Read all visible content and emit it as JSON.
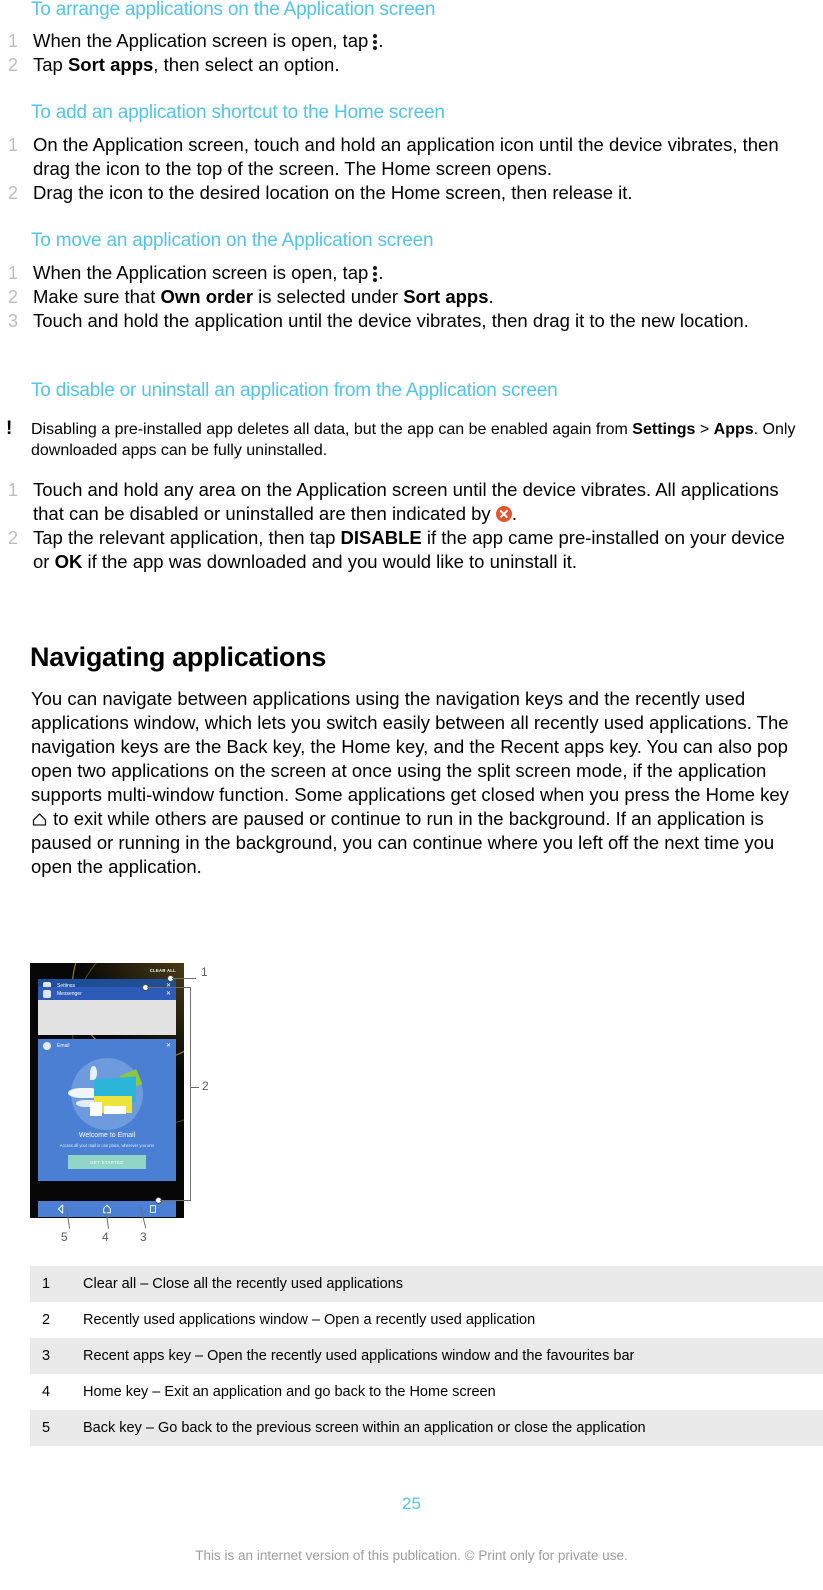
{
  "sections": [
    {
      "heading": "To arrange applications on the Application screen",
      "steps": [
        {
          "num": "1",
          "pre": "When the Application screen is open, tap ",
          "icon": "overflow-menu-icon",
          "post": "."
        },
        {
          "num": "2",
          "pre": "Tap ",
          "bold": "Sort apps",
          "post": ", then select an option."
        }
      ]
    },
    {
      "heading": "To add an application shortcut to the Home screen",
      "steps": [
        {
          "num": "1",
          "pre": "On the Application screen, touch and hold an application icon until the device vibrates, then drag the icon to the top of the screen. The Home screen opens."
        },
        {
          "num": "2",
          "pre": "Drag the icon to the desired location on the Home screen, then release it."
        }
      ]
    },
    {
      "heading": "To move an application on the Application screen",
      "steps": [
        {
          "num": "1",
          "pre": "When the Application screen is open, tap ",
          "icon": "overflow-menu-icon",
          "post": "."
        },
        {
          "num": "2",
          "pre": "Make sure that ",
          "bold": "Own order",
          "mid": " is selected under ",
          "bold2": "Sort apps",
          "post": "."
        },
        {
          "num": "3",
          "pre": "Touch and hold the application until the device vibrates, then drag it to the new location."
        }
      ]
    },
    {
      "heading": "To disable or uninstall an application from the Application screen",
      "note": {
        "icon": "!",
        "t1": "Disabling a pre-installed app deletes all data, but the app can be enabled again from ",
        "b1": "Settings",
        "t2": " > ",
        "b2": "Apps",
        "t3": ". Only downloaded apps can be fully uninstalled."
      },
      "steps": [
        {
          "num": "1",
          "pre": "Touch and hold any area on the Application screen until the device vibrates. All applications that can be disabled or uninstalled are then indicated by ",
          "icon": "x-circle-icon",
          "post": "."
        },
        {
          "num": "2",
          "pre": "Tap the relevant application, then tap ",
          "bold": "DISABLE",
          "mid": " if the app came pre-installed on your device or ",
          "bold2": "OK",
          "post": " if the app was downloaded and you would like to uninstall it."
        }
      ]
    }
  ],
  "navigating": {
    "heading": "Navigating applications",
    "paragraph_part1": "You can navigate between applications using the navigation keys and the recently used applications window, which lets you switch easily between all recently used applications. The navigation keys are the Back key, the Home key, and the Recent apps key. You can also pop open two applications on the screen at once using the split screen mode, if the application supports multi-window function. Some applications get closed when you press the Home key ",
    "home_icon": "home-key-icon",
    "paragraph_part2": " to exit while others are paused or continue to run in the background. If an application is paused or running in the background, you can continue where you left off the next time you open the application."
  },
  "figure": {
    "clear_all_label": "CLEAR ALL",
    "cards": [
      {
        "title": "Settings",
        "icon": "settings-icon",
        "close": "✕"
      },
      {
        "title": "Messenger",
        "icon": "messenger-icon",
        "close": "✕"
      },
      {
        "title": "Email",
        "icon": "email-icon",
        "close": "✕"
      }
    ],
    "email_card": {
      "title": "Welcome to Email",
      "subtitle": "Access all your mail in one place, wherever you are!",
      "button": "GET STARTED"
    },
    "callouts": [
      "1",
      "2",
      "3",
      "4",
      "5"
    ],
    "nav_keys": [
      "back-key-icon",
      "home-key-icon",
      "recent-apps-key-icon"
    ]
  },
  "legend": {
    "rows": [
      {
        "num": "1",
        "desc": "Clear all – Close all the recently used applications"
      },
      {
        "num": "2",
        "desc": "Recently used applications window – Open a recently used application"
      },
      {
        "num": "3",
        "desc": "Recent apps key – Open the recently used applications window and the favourites bar"
      },
      {
        "num": "4",
        "desc": "Home key – Exit an application and go back to the Home screen"
      },
      {
        "num": "5",
        "desc": "Back key – Go back to the previous screen within an application or close the application"
      }
    ]
  },
  "footer": {
    "page_number": "25",
    "notice": "This is an internet version of this publication. © Print only for private use."
  },
  "colors": {
    "heading_cyan": "#52c3e9",
    "step_number_grey": "#bdbdbd",
    "x_circle_orange": "#e8542c",
    "legend_row_shade": "#e9e9e9",
    "footer_grey": "#9d9d9d"
  }
}
